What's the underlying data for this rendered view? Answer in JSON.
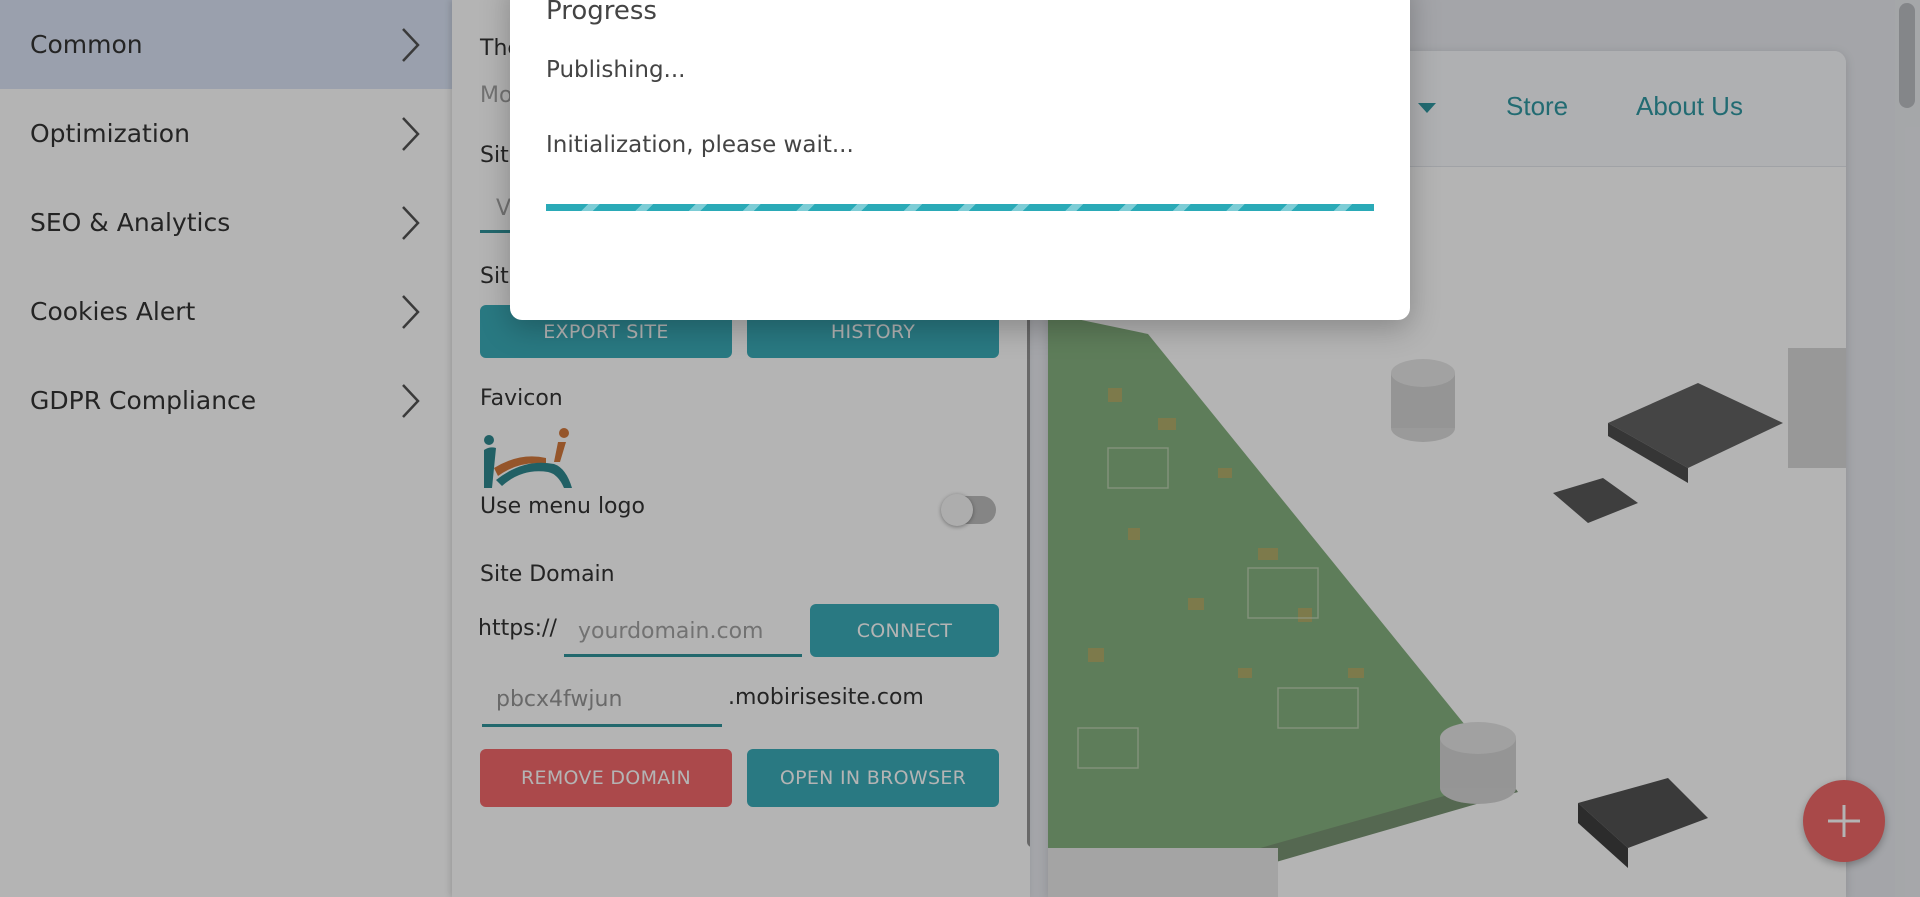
{
  "left_nav": {
    "items": [
      {
        "label": "Common",
        "active": true
      },
      {
        "label": "Optimization",
        "active": false
      },
      {
        "label": "SEO & Analytics",
        "active": false
      },
      {
        "label": "Cookies Alert",
        "active": false
      },
      {
        "label": "GDPR Compliance",
        "active": false
      }
    ]
  },
  "settings": {
    "theme_label_partial": "The",
    "theme_value_partial": "Mo",
    "site_label_partial": "Site",
    "site_value_partial": "V",
    "site2_label_partial": "Site",
    "export_button": "EXPORT SITE",
    "history_button": "HISTORY",
    "favicon_label": "Favicon",
    "use_menu_logo_label": "Use menu logo",
    "use_menu_logo_on": false,
    "site_domain_label": "Site Domain",
    "protocol_prefix": "https://",
    "domain_placeholder": "yourdomain.com",
    "connect_button": "CONNECT",
    "subdomain_value": "pbcx4fwjun",
    "subdomain_suffix": ".mobirisesite.com",
    "remove_domain_button": "REMOVE DOMAIN",
    "open_in_browser_button": "OPEN IN BROWSER"
  },
  "preview": {
    "nav_links": [
      "Store",
      "About Us"
    ]
  },
  "modal": {
    "title": "Progress",
    "status": "Publishing...",
    "message": "Initialization, please wait...",
    "progress": 1.0
  },
  "colors": {
    "accent": "#2aa5b2",
    "danger": "#f25b5f",
    "active_nav": "#d7e1f4"
  }
}
